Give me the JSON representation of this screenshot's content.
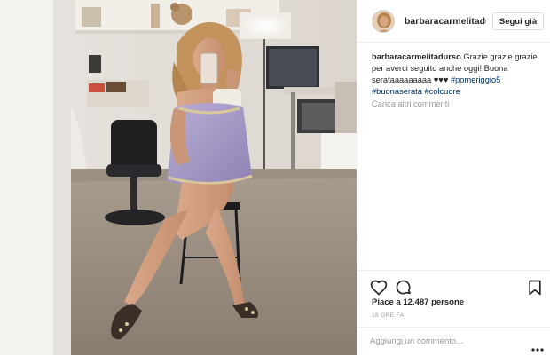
{
  "post": {
    "username": "barbaracarmelitadurso",
    "follow_label": "Segui già",
    "caption": {
      "username": "barbaracarmelitadurso",
      "text": "Grazie grazie grazie per averci seguito anche oggi! Buona serataaaaaaaaa ♥♥♥",
      "hashtags": [
        "#pomeriggio5",
        "#buonaserata",
        "#colcuore"
      ]
    },
    "load_more_label": "Carica altri commenti",
    "likes_label": "Piace a 12.487 persone",
    "time_label": "18 ORE FA",
    "comment_placeholder": "Aggiungi un commento...",
    "icons": {
      "like": "heart-outline-icon",
      "comment": "speech-bubble-icon",
      "save": "bookmark-icon",
      "more": "ellipsis-icon",
      "avatar": "profile-photo"
    },
    "colors": {
      "text": "#262626",
      "secondary": "#999999",
      "hashtag": "#003569",
      "border": "#efefef",
      "dress": "#a89bc9"
    }
  }
}
